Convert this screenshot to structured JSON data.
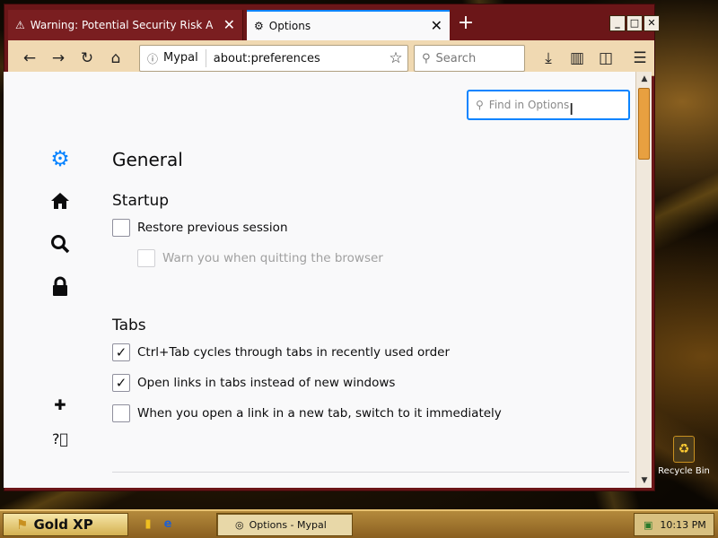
{
  "browser": {
    "tabs": [
      {
        "title": "Warning: Potential Security Risk A",
        "icon": "warning-icon"
      },
      {
        "title": "Options",
        "icon": "gear-icon"
      }
    ],
    "urlbar": {
      "site": "Mypal",
      "url": "about:preferences"
    },
    "search": {
      "placeholder": "Search"
    }
  },
  "preferences": {
    "find_placeholder": "Find in Options",
    "category_title": "General",
    "startup": {
      "heading": "Startup",
      "restore_label": "Restore previous session",
      "restore_checked": false,
      "warn_quit_label": "Warn you when quitting the browser",
      "warn_quit_checked": false,
      "warn_quit_disabled": true
    },
    "tabs": {
      "heading": "Tabs",
      "ctrl_tab_label": "Ctrl+Tab cycles through tabs in recently used order",
      "ctrl_tab_checked": true,
      "open_links_label": "Open links in tabs instead of new windows",
      "open_links_checked": true,
      "switch_label": "When you open a link in a new tab, switch to it immediately",
      "switch_checked": false
    }
  },
  "desktop": {
    "recycle_bin": "Recycle Bin"
  },
  "taskbar": {
    "start_label": "Gold XP",
    "window_button": "Options - Mypal",
    "clock": "10:13 PM"
  },
  "colors": {
    "accent": "#0a84ff",
    "titlebar": "#6b1618",
    "toolbar": "#f0d9b2"
  }
}
